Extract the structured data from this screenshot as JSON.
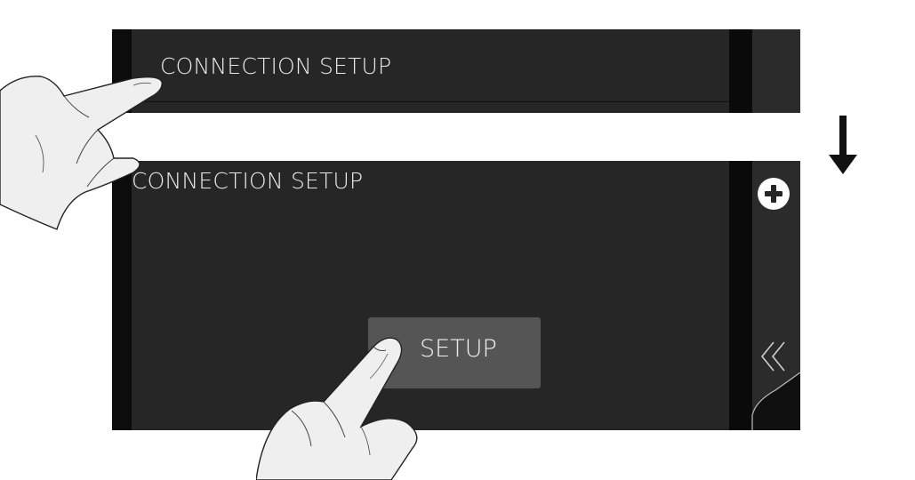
{
  "top_panel": {
    "title": "CONNECTION SETUP"
  },
  "bottom_panel": {
    "title": "CONNECTION SETUP",
    "setup_button_label": "SETUP",
    "icons": {
      "add": "plus-circle-icon",
      "back": "double-chevron-left-icon"
    }
  },
  "transition_icon": "down-arrow-icon",
  "colors": {
    "panel_bg": "#262626",
    "button_bg": "#555555",
    "text": "#eaeaea",
    "strip": "#0c0c0c"
  }
}
